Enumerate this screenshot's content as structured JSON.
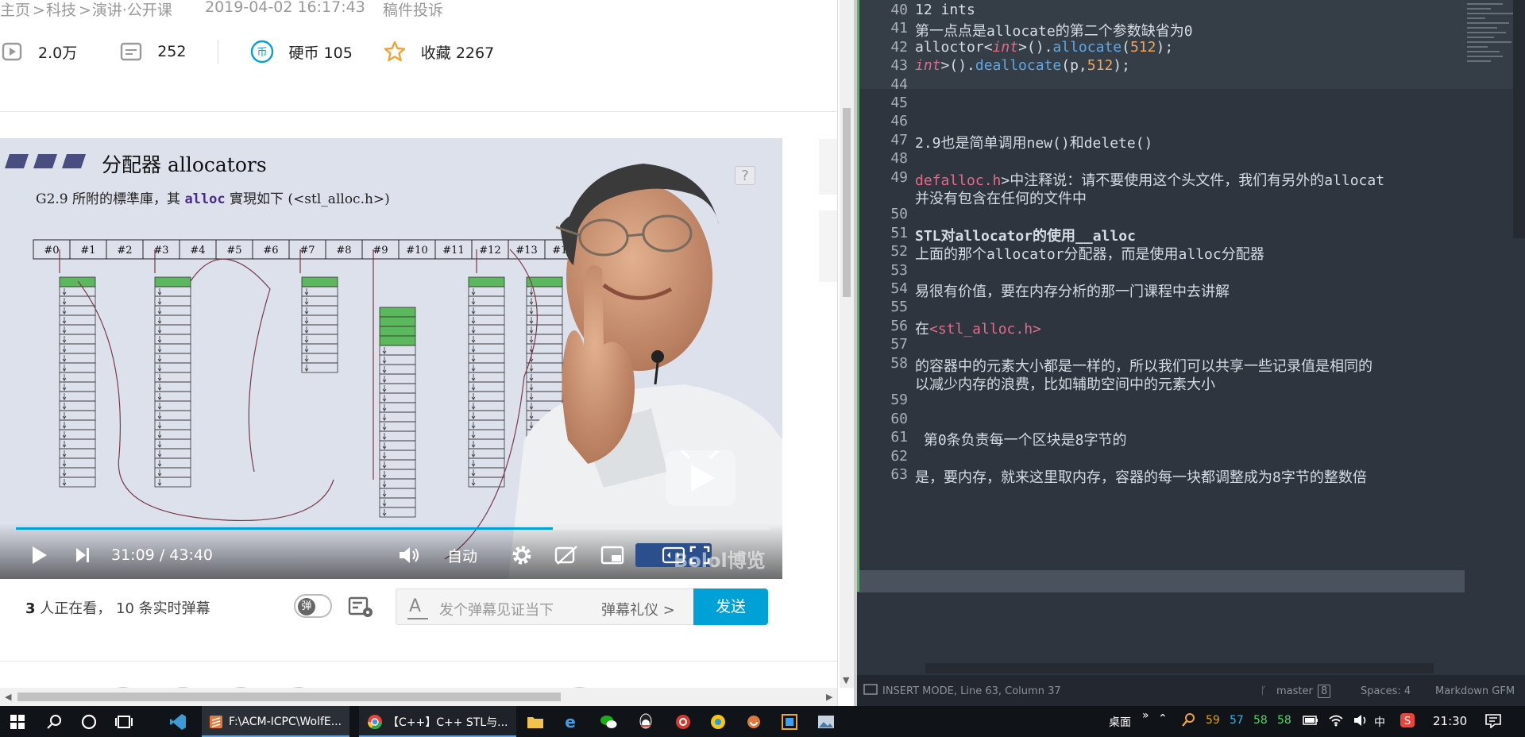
{
  "browser": {
    "breadcrumb": [
      "主页",
      "科技",
      "演讲·公开课"
    ],
    "breadcrumb_sep": ">",
    "date": "2019-04-02 16:17:43",
    "submission": "稿件投诉",
    "stats": {
      "views": "2.0万",
      "danmaku": "252",
      "coins": "硬币 105",
      "favorites": "收藏 2267"
    }
  },
  "video": {
    "slide_title": "分配器 allocators",
    "slide_subtitle_pre": "G2.9 所附的標準庫，其",
    "slide_subtitle_code": "alloc",
    "slide_subtitle_post": "實現如下 (<stl_alloc.h>)",
    "help_glyph": "?",
    "bins": [
      "#0",
      "#1",
      "#2",
      "#3",
      "#4",
      "#5",
      "#6",
      "#7",
      "#8",
      "#9",
      "#10",
      "#11",
      "#12",
      "#13",
      "#14"
    ],
    "current_time": "31:09",
    "separator": "/",
    "duration": "43:40",
    "progress_fraction": 0.713,
    "quality": "自动",
    "watermark": "Bolol博览"
  },
  "danmaku_bar": {
    "watching_count": "3",
    "watching_text": "人正在看，",
    "live_danmaku": "10 条实时弹幕",
    "toggle_label": "弹",
    "input_placeholder": "发个弹幕见证当下",
    "etiquette": "弹幕礼仪 >",
    "send": "发送"
  },
  "editor": {
    "lines": [
      {
        "n": "40",
        "segments": [
          [
            "12 ints",
            ""
          ]
        ]
      },
      {
        "n": "41",
        "segments": [
          [
            "第一点点是",
            ""
          ],
          [
            "allocate",
            ""
          ],
          [
            "的第二个参数缺省为",
            ""
          ],
          [
            "0",
            ""
          ]
        ]
      },
      {
        "n": "42",
        "segments": [
          [
            "alloctor<",
            ""
          ],
          [
            "int",
            "kw"
          ],
          [
            ">().",
            ""
          ],
          [
            "allocate",
            "fn"
          ],
          [
            "(",
            ""
          ],
          [
            "512",
            "num"
          ],
          [
            ");",
            ""
          ]
        ]
      },
      {
        "n": "43",
        "segments": [
          [
            "int",
            "kw"
          ],
          [
            ">().",
            ""
          ],
          [
            "deallocate",
            "fn"
          ],
          [
            "(p,",
            ""
          ],
          [
            "512",
            "num"
          ],
          [
            ");",
            ""
          ]
        ]
      },
      {
        "n": "44",
        "segments": []
      },
      {
        "n": "45",
        "segments": []
      },
      {
        "n": "46",
        "segments": []
      },
      {
        "n": "47",
        "segments": [
          [
            "2.9也是简单调用new()和delete()",
            ""
          ]
        ]
      },
      {
        "n": "48",
        "segments": []
      },
      {
        "n": "49",
        "segments": [
          [
            "defalloc.h",
            "tag"
          ],
          [
            ">中注释说：请不要使用这个头文件，我们有另外的allocat",
            ""
          ]
        ]
      },
      {
        "n": "",
        "segments": [
          [
            "并没有包含在任何的文件中",
            ""
          ]
        ]
      },
      {
        "n": "50",
        "segments": []
      },
      {
        "n": "51",
        "segments": [
          [
            "STL对allocator的使用__alloc",
            "bold"
          ]
        ]
      },
      {
        "n": "52",
        "segments": [
          [
            "上面的那个allocator分配器，而是使用alloc分配器",
            ""
          ]
        ]
      },
      {
        "n": "53",
        "segments": []
      },
      {
        "n": "54",
        "segments": [
          [
            "易很有价值，要在内存分析的那一门课程中去讲解",
            ""
          ]
        ]
      },
      {
        "n": "55",
        "segments": []
      },
      {
        "n": "56",
        "segments": [
          [
            "在",
            ""
          ],
          [
            "<stl_alloc.h>",
            "tag"
          ]
        ]
      },
      {
        "n": "57",
        "segments": []
      },
      {
        "n": "58",
        "segments": [
          [
            "的容器中的元素大小都是一样的，所以我们可以共享一些记录值是相同的",
            ""
          ]
        ]
      },
      {
        "n": "",
        "segments": [
          [
            "以减少内存的浪费，比如辅助空间中的元素大小",
            ""
          ]
        ]
      },
      {
        "n": "59",
        "segments": []
      },
      {
        "n": "60",
        "segments": []
      },
      {
        "n": "61",
        "segments": [
          [
            " 第0条负责每一个区块是8字节的",
            ""
          ]
        ]
      },
      {
        "n": "62",
        "segments": []
      },
      {
        "n": "63",
        "segments": [
          [
            "是，要内存，就来这里取内存，容器的每一块都调整成为8字节的整数倍",
            ""
          ]
        ]
      }
    ],
    "status": {
      "mode": "INSERT MODE, Line 63, Column 37",
      "branch": "master",
      "branch_badge": "8",
      "spaces": "Spaces: 4",
      "syntax": "Markdown GFM"
    }
  },
  "taskbar": {
    "apps": [
      {
        "label": "F:\\ACM-ICPC\\WolfE...",
        "color": "#e8793a"
      },
      {
        "label": "【C++】C++ STL与...",
        "color": "#4a90e2"
      }
    ],
    "desktop": "桌面",
    "chevron": "»",
    "tray_nums": [
      "59",
      "57",
      "58",
      "58"
    ],
    "tray_colors": [
      "#e0a500",
      "#2fb4e6",
      "#4cd964",
      "#4cd964"
    ],
    "ime": "中",
    "clock": "21:30"
  }
}
